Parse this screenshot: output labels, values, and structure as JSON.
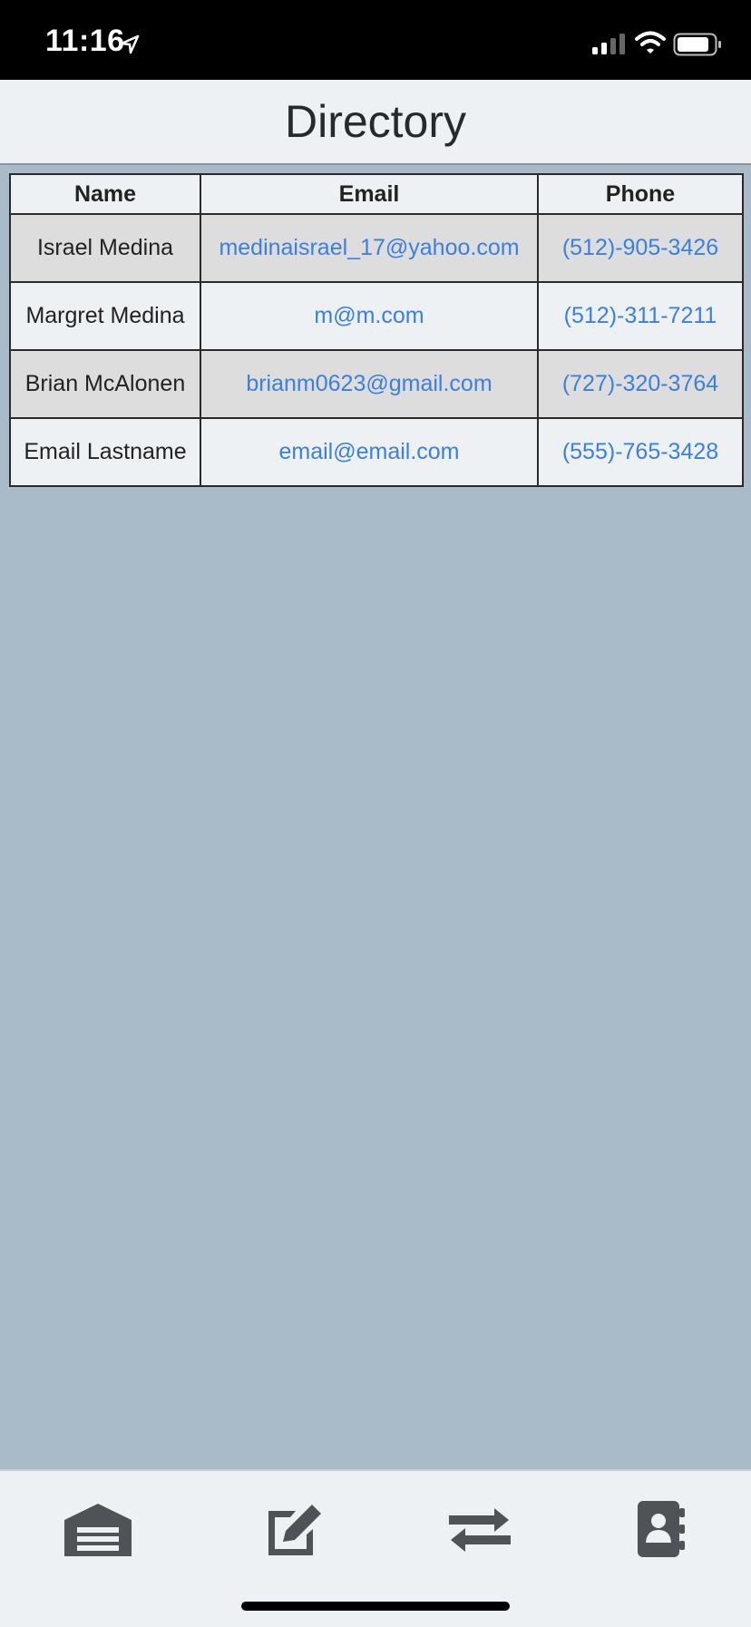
{
  "status_bar": {
    "time": "11:16",
    "icons": [
      "location-arrow-icon",
      "cellular-signal-icon",
      "wifi-icon",
      "battery-icon"
    ]
  },
  "header": {
    "title": "Directory"
  },
  "table": {
    "columns": [
      "Name",
      "Email",
      "Phone"
    ],
    "rows": [
      {
        "name": "Israel Medina",
        "email": "medinaisrael_17@yahoo.com",
        "phone": "(512)-905-3426"
      },
      {
        "name": "Margret Medina",
        "email": "m@m.com",
        "phone": "(512)-311-7211"
      },
      {
        "name": "Brian McAlonen",
        "email": "brianm0623@gmail.com",
        "phone": "(727)-320-3764"
      },
      {
        "name": "Email Lastname",
        "email": "email@email.com",
        "phone": "(555)-765-3428"
      }
    ]
  },
  "tab_bar": {
    "items": [
      {
        "icon": "warehouse-icon"
      },
      {
        "icon": "edit-icon"
      },
      {
        "icon": "exchange-icon"
      },
      {
        "icon": "address-book-icon"
      }
    ]
  },
  "colors": {
    "background": "#a9bbc9",
    "header": "#edf1f4",
    "link": "#3b7fe0",
    "row_shaded": "#dddddd",
    "icon": "#4f5256"
  }
}
